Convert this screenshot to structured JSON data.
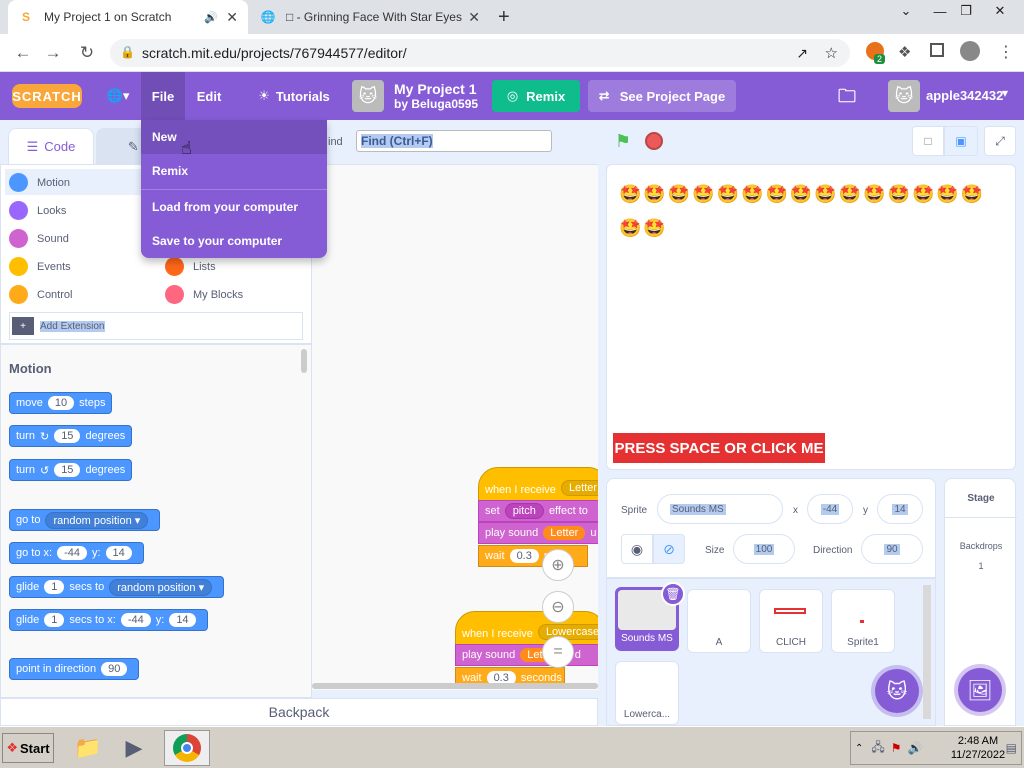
{
  "browser": {
    "tabs": [
      {
        "title": "My Project 1 on Scratch",
        "active": true
      },
      {
        "title": "□ - Grinning Face With Star Eyes",
        "active": false
      }
    ],
    "new_tab": "+",
    "url": "scratch.mit.edu/projects/767944577/editor/",
    "ext_badge": "2"
  },
  "menubar": {
    "logo": "SCRATCH",
    "file": "File",
    "edit": "Edit",
    "tutorials": "Tutorials",
    "project_title": "My Project 1",
    "project_by": "by Beluga0595",
    "remix": "Remix",
    "see_project": "See Project Page",
    "username": "apple342432"
  },
  "file_menu": {
    "items": [
      "New",
      "Remix",
      "Load from your computer",
      "Save to your computer"
    ]
  },
  "editor_tabs": {
    "code": "Code",
    "costumes": "C"
  },
  "find": {
    "label": "ind",
    "placeholder": "Find (Ctrl+F)"
  },
  "categories": [
    {
      "label": "Motion",
      "color": "#4c97ff"
    },
    {
      "label": "Looks",
      "color": "#9966ff"
    },
    {
      "label": "Sound",
      "color": "#cf63cf"
    },
    {
      "label": "Events",
      "color": "#ffbf00"
    },
    {
      "label": "Control",
      "color": "#ffab19"
    },
    {
      "label": "Lists",
      "color": "#ff661a"
    },
    {
      "label": "My Blocks",
      "color": "#ff6680"
    }
  ],
  "add_extension": "Add Extension",
  "palette": {
    "heading": "Motion",
    "move": {
      "a": "move",
      "v": "10",
      "b": "steps"
    },
    "turn_right": {
      "a": "turn",
      "v": "15",
      "b": "degrees"
    },
    "turn_left": {
      "a": "turn",
      "v": "15",
      "b": "degrees"
    },
    "goto": {
      "a": "go to",
      "v": "random position"
    },
    "goto_xy": {
      "a": "go to x:",
      "x": "-44",
      "b": "y:",
      "y": "14"
    },
    "glide": {
      "a": "glide",
      "v": "1",
      "b": "secs to",
      "c": "random position"
    },
    "glide_xy": {
      "a": "glide",
      "v": "1",
      "b": "secs to x:",
      "x": "-44",
      "c": "y:",
      "y": "14"
    },
    "point": {
      "a": "point in direction",
      "v": "90"
    }
  },
  "workspace": {
    "script1": {
      "hat": "when I receive",
      "hat_v": "Letter",
      "set": "set",
      "set_v": "pitch",
      "set_b": "effect to",
      "play": "play sound",
      "play_v": "Letter",
      "play_b": "u",
      "wait": "wait",
      "wait_v": "0.3",
      "wait_b": "nds"
    },
    "script2": {
      "hat": "when I receive",
      "hat_v": "Lowercase",
      "play": "play sound",
      "play_v": "Lett",
      "play_b": "ntil d",
      "wait": "wait",
      "wait_v": "0.3",
      "wait_b": "seconds"
    }
  },
  "backpack": "Backpack",
  "stage": {
    "press": "PRESS SPACE OR CLICK ME"
  },
  "sprite_info": {
    "sprite_label": "Sprite",
    "sprite_name": "Sounds MS",
    "x_label": "x",
    "x": "-44",
    "y_label": "y",
    "y": "14",
    "size_label": "Size",
    "size": "100",
    "direction_label": "Direction",
    "direction": "90"
  },
  "sprites": [
    "Sounds MS",
    "A",
    "CLICH",
    "Sprite1",
    "Lowerca..."
  ],
  "stage_pane": {
    "title": "Stage",
    "backdrops_label": "Backdrops",
    "backdrops_count": "1"
  },
  "taskbar": {
    "start": "Start",
    "time": "2:48 AM",
    "date": "11/27/2022"
  }
}
